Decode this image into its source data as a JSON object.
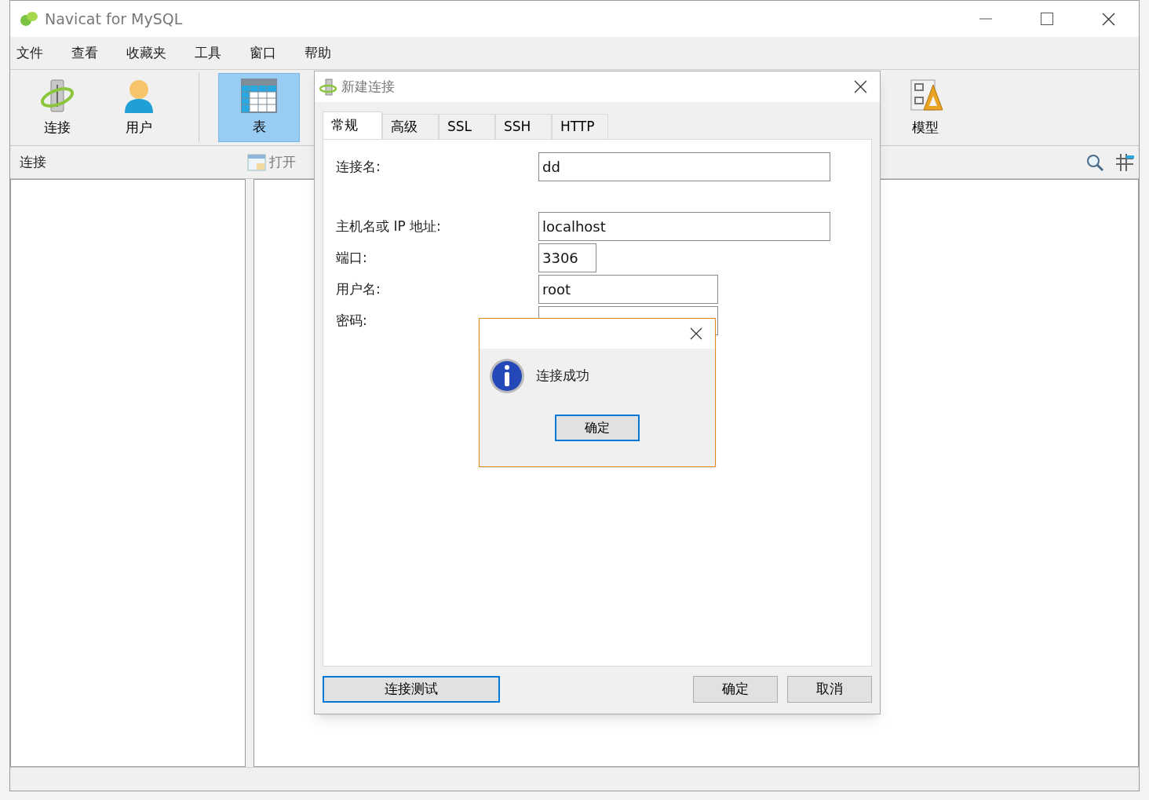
{
  "window": {
    "title": "Navicat for MySQL"
  },
  "menu": [
    "文件",
    "查看",
    "收藏夹",
    "工具",
    "窗口",
    "帮助"
  ],
  "toolbar": [
    {
      "label": "连接",
      "kind": "connection",
      "selected": false
    },
    {
      "label": "用户",
      "kind": "user",
      "selected": false
    },
    {
      "label": "表",
      "kind": "table",
      "selected": true
    },
    {
      "label": "模型",
      "kind": "model",
      "selected": false
    }
  ],
  "object_bar": {
    "panel_title": "连接",
    "open_button": "打开"
  },
  "dialog": {
    "title": "新建连接",
    "tabs": [
      {
        "label": "常规",
        "selected": true
      },
      {
        "label": "高级",
        "selected": false
      },
      {
        "label": "SSL",
        "selected": false
      },
      {
        "label": "SSH",
        "selected": false
      },
      {
        "label": "HTTP",
        "selected": false
      }
    ],
    "fields": [
      {
        "label": "连接名:",
        "value": "dd"
      },
      {
        "label": "主机名或 IP 地址:",
        "value": "localhost"
      },
      {
        "label": "端口:",
        "value": "3306"
      },
      {
        "label": "用户名:",
        "value": "root"
      },
      {
        "label": "密码:"
      }
    ],
    "buttons": [
      {
        "label": "连接测试",
        "focused": true
      },
      {
        "label": "确定",
        "focused": false
      },
      {
        "label": "取消",
        "focused": false
      }
    ]
  },
  "message_box": {
    "message": "连接成功",
    "button": {
      "label": "确定",
      "focused": true
    }
  }
}
